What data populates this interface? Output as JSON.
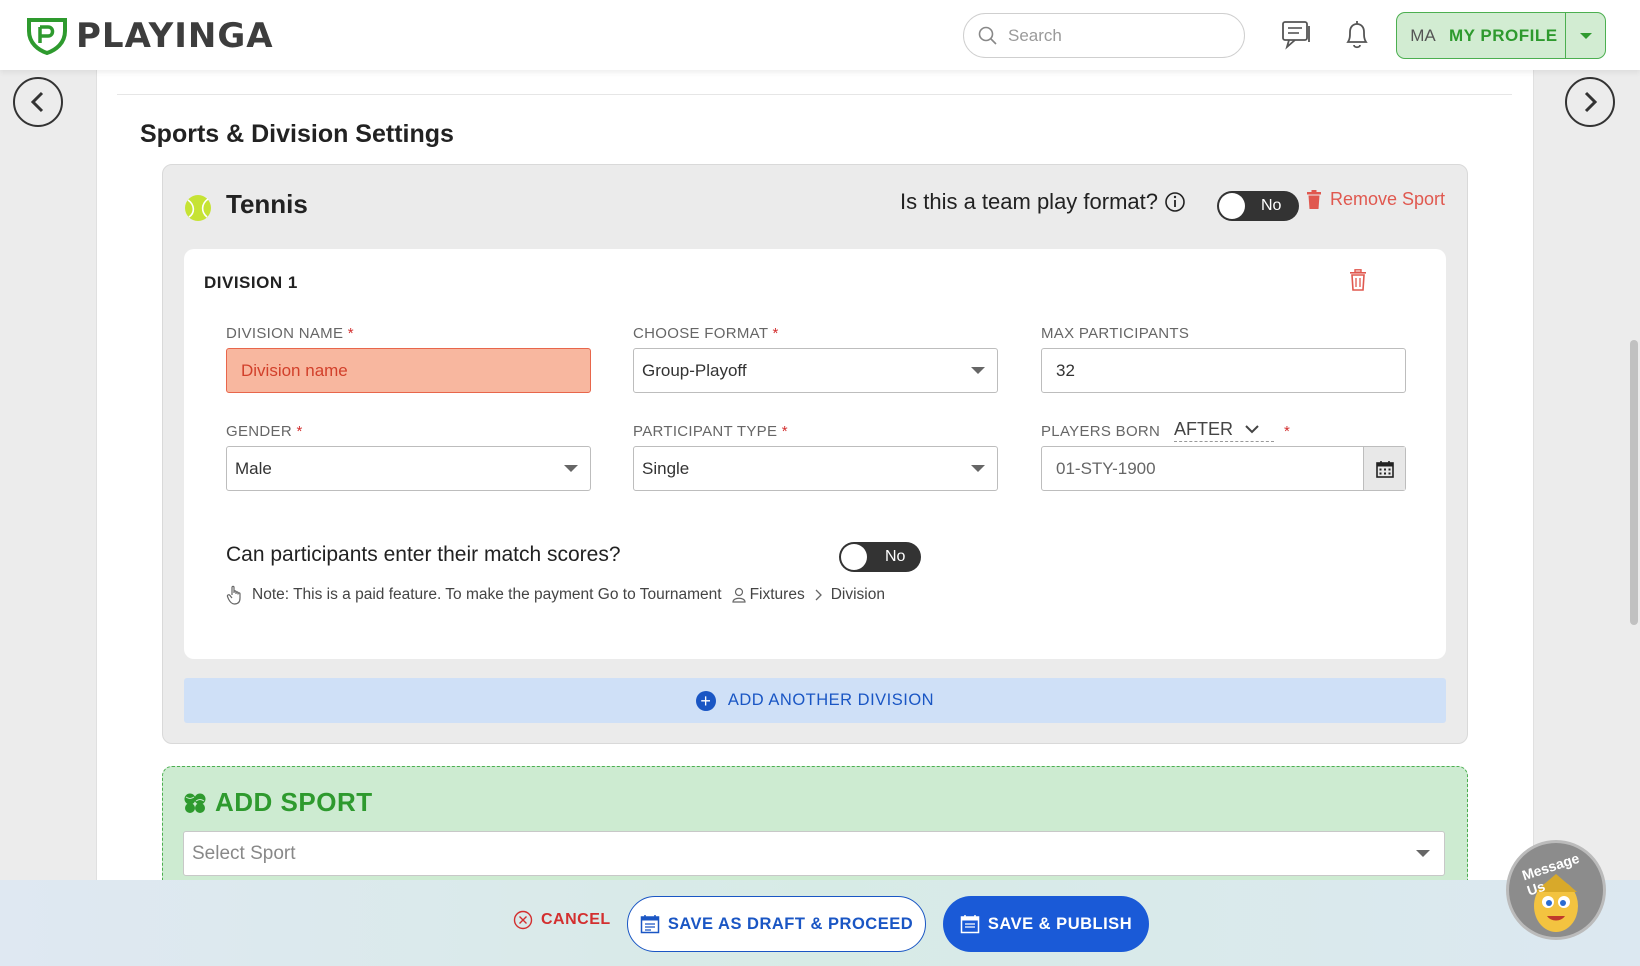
{
  "header": {
    "logo_text": "PLAYINGA",
    "search_placeholder": "Search",
    "profile_initials": "MA",
    "profile_label": "MY PROFILE"
  },
  "section_title": "Sports & Division Settings",
  "sport": {
    "name": "Tennis",
    "team_play_question": "Is this a team play format?",
    "team_play_toggle": "No",
    "remove_label": "Remove Sport"
  },
  "division": {
    "title": "DIVISION 1",
    "name_label": "DIVISION NAME",
    "name_placeholder": "Division name",
    "format_label": "CHOOSE FORMAT",
    "format_value": "Group-Playoff",
    "max_label": "MAX PARTICIPANTS",
    "max_value": "32",
    "gender_label": "GENDER",
    "gender_value": "Male",
    "participant_type_label": "PARTICIPANT TYPE",
    "participant_type_value": "Single",
    "players_born_label": "PLAYERS BORN",
    "players_born_select": "AFTER",
    "born_date_value": "01-STY-1900",
    "required_mark": "*",
    "scores_question": "Can participants enter their match scores?",
    "scores_toggle": "No",
    "note_text": "Note: This is a paid feature. To make the payment Go to Tournament",
    "note_crumb_1": "Fixtures",
    "note_crumb_2": "Division"
  },
  "add_division_label": "ADD ANOTHER DIVISION",
  "add_sport": {
    "title": "ADD SPORT",
    "select_placeholder": "Select Sport"
  },
  "actions": {
    "cancel": "CANCEL",
    "save_draft": "SAVE AS DRAFT & PROCEED",
    "save_publish": "SAVE & PUBLISH"
  },
  "chat_widget_label": "Message Us",
  "colors": {
    "brand_green": "#2e9a2e",
    "primary_blue": "#1a5ad7",
    "error_red": "#d32f2f"
  }
}
